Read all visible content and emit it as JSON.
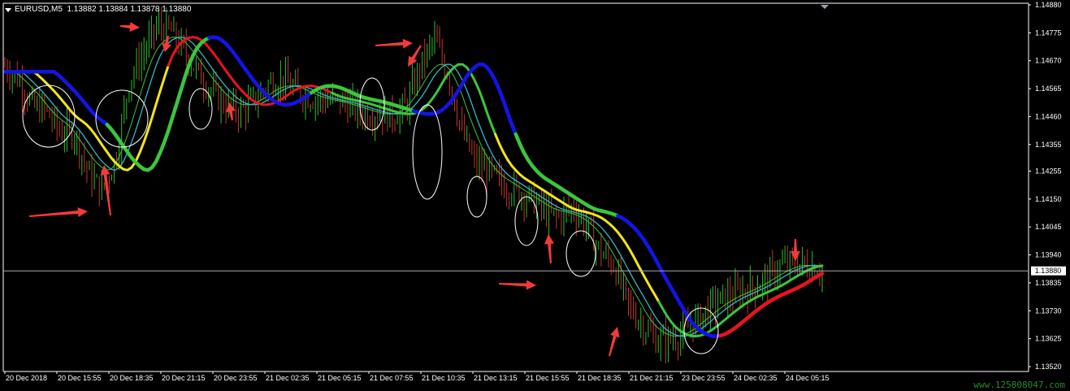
{
  "header": {
    "symbol_timeframe": "EURUSD,M5",
    "quote": "1.13882 1.13884 1.13878 1.13880"
  },
  "current_price_label": "1.13880",
  "watermark": "www.125808047.com",
  "colors": {
    "background": "#000000",
    "axis": "#ffffff",
    "bull_candle": "#2bbf2b",
    "bear_candle": "#c0392b",
    "ma_green": "#3cc63c",
    "ma_yellow": "#f2e51c",
    "ma_blue": "#1414e6",
    "ma_red": "#e8141e",
    "ma_cyan": "#36b6c8",
    "arrow": "#f23a3a",
    "circle": "#ffffff"
  },
  "chart_data": {
    "type": "candlestick",
    "symbol": "EURUSD",
    "timeframe": "M5",
    "ylim": [
      1.1352,
      1.1488
    ],
    "y_ticks": [
      "1.14880",
      "1.14775",
      "1.14670",
      "1.14565",
      "1.14460",
      "1.14355",
      "1.14255",
      "1.14150",
      "1.14045",
      "1.13940",
      "1.13835",
      "1.13730",
      "1.13625",
      "1.13520"
    ],
    "x_ticks": [
      "20 Dec 2018",
      "20 Dec 15:55",
      "20 Dec 18:35",
      "20 Dec 21:15",
      "20 Dec 23:55",
      "21 Dec 02:35",
      "21 Dec 05:15",
      "21 Dec 07:55",
      "21 Dec 10:35",
      "21 Dec 13:15",
      "21 Dec 15:55",
      "21 Dec 18:35",
      "21 Dec 21:15",
      "23 Dec 23:55",
      "24 Dec 02:35",
      "24 Dec 05:15"
    ],
    "current_price": 1.1388,
    "price_path": [
      1.1465,
      1.146,
      1.145,
      1.1448,
      1.144,
      1.144,
      1.1425,
      1.1418,
      1.143,
      1.146,
      1.147,
      1.148,
      1.1478,
      1.147,
      1.1462,
      1.1455,
      1.145,
      1.1448,
      1.1452,
      1.1458,
      1.146,
      1.1456,
      1.1453,
      1.1452,
      1.1452,
      1.145,
      1.1447,
      1.1447,
      1.1446,
      1.145,
      1.1465,
      1.1475,
      1.1462,
      1.144,
      1.1428,
      1.1425,
      1.142,
      1.1418,
      1.1415,
      1.141,
      1.1408,
      1.1412,
      1.1405,
      1.1395,
      1.139,
      1.1375,
      1.1368,
      1.1362,
      1.1362,
      1.1365,
      1.137,
      1.1375,
      1.1378,
      1.138,
      1.1382,
      1.1385,
      1.139,
      1.1391,
      1.139,
      1.1388
    ],
    "moving_averages": [
      {
        "segments": [
          {
            "color": "blue",
            "values": [
              1.1455,
              1.146,
              1.1463
            ]
          },
          {
            "color": "yellow",
            "values": [
              1.1463,
              1.1458,
              1.145
            ]
          },
          {
            "color": "green",
            "values": [
              1.145,
              1.144,
              1.143
            ]
          }
        ]
      },
      {
        "segments": [
          {
            "color": "green",
            "values": [
              1.1463,
              1.1458
            ]
          },
          {
            "color": "yellow",
            "values": [
              1.1458,
              1.1445,
              1.144,
              1.143,
              1.1425
            ]
          },
          {
            "color": "green",
            "values": [
              1.1425,
              1.1418
            ]
          }
        ]
      }
    ],
    "annotations": [
      {
        "type": "circle",
        "label": ""
      },
      {
        "type": "arrow",
        "label": ""
      }
    ]
  }
}
